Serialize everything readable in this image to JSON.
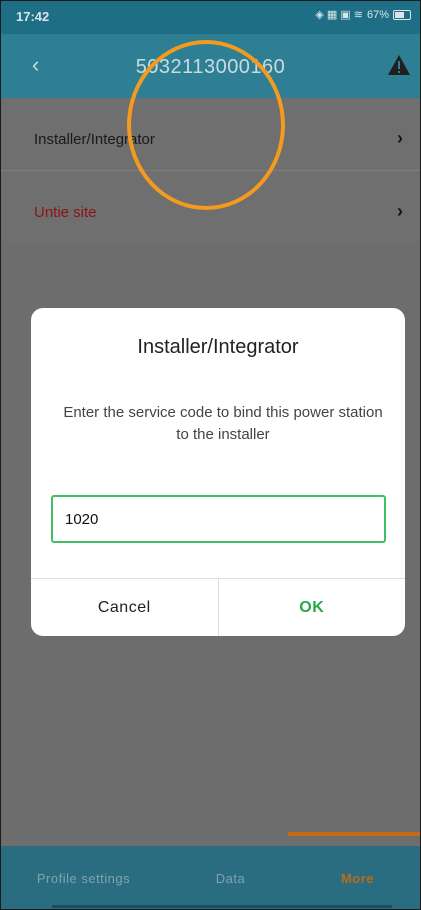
{
  "status_bar": {
    "time": "17:42",
    "battery": "67%"
  },
  "header": {
    "back_icon": "chevron-left-icon",
    "title": "5032113000160",
    "warning_icon": "warning-triangle-icon"
  },
  "list": {
    "items": [
      {
        "label": "Installer/Integrator",
        "color": "#1a1a1a"
      },
      {
        "label": "Untie site",
        "color": "#8e1414"
      }
    ]
  },
  "dialog": {
    "title": "Installer/Integrator",
    "message": "Enter the service code to bind this power station to the installer",
    "input_value": "1020",
    "cancel_label": "Cancel",
    "ok_label": "OK",
    "ok_color": "#27a844"
  },
  "bottom_nav": {
    "tabs": [
      {
        "label": "Profile settings"
      },
      {
        "label": "Data"
      },
      {
        "label": "More",
        "active": true
      }
    ]
  },
  "colors": {
    "accent": "#2e7f94",
    "annotation": "#f39a1f"
  }
}
